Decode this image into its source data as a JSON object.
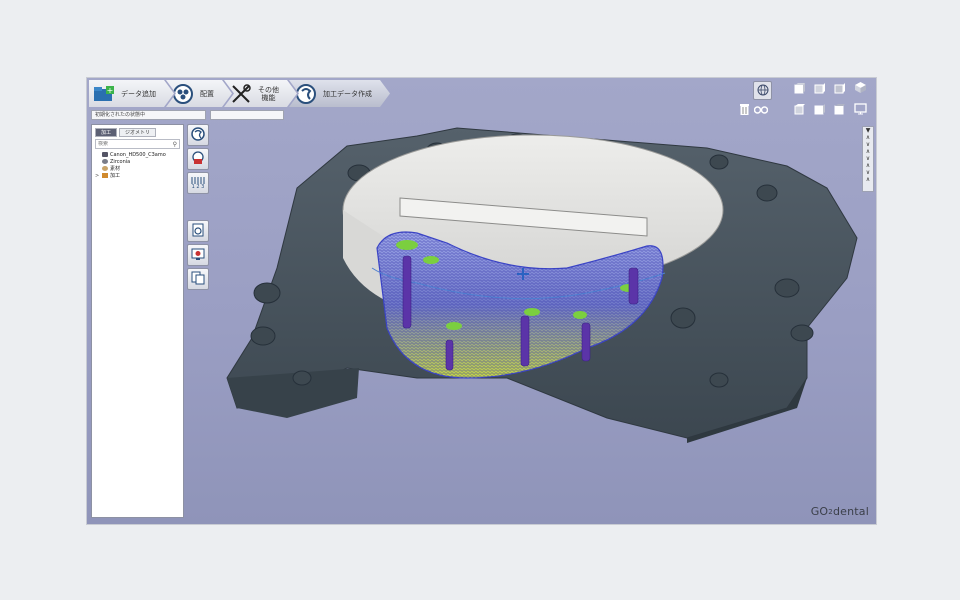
{
  "workflow": {
    "steps": [
      {
        "label": "データ追加",
        "icon": "folder-add-icon",
        "active": false
      },
      {
        "label": "配置",
        "icon": "placement-icon",
        "active": false
      },
      {
        "label": "その他\n機能",
        "icon": "tools-icon",
        "active": false
      },
      {
        "label": "加工データ作成",
        "icon": "toolpath-icon",
        "active": true
      }
    ]
  },
  "progress": {
    "label": "初期化されたの状態中",
    "value": ""
  },
  "panel": {
    "tabs": [
      {
        "label": "加工",
        "active": true
      },
      {
        "label": "ジオメトリ",
        "active": false
      }
    ],
    "search_placeholder": "検索",
    "tree": [
      {
        "label": "Canon_HD500_C3amo",
        "icon": "machine-icon",
        "expander": ""
      },
      {
        "label": "Zirconia",
        "icon": "material-icon",
        "expander": ""
      },
      {
        "label": "素材",
        "icon": "blank-icon",
        "expander": ""
      },
      {
        "label": "加工",
        "icon": "machining-icon",
        "expander": ">"
      }
    ]
  },
  "left_tools": [
    {
      "icon": "calculate-toolpath-icon"
    },
    {
      "icon": "delete-toolpath-icon"
    },
    {
      "icon": "toolpath-order-icon",
      "text": "1 2 3"
    },
    {
      "icon": "export-nc-icon"
    },
    {
      "icon": "simulation-icon"
    },
    {
      "icon": "report-icon"
    }
  ],
  "view_strip": [
    "▼",
    "∧",
    "∨",
    "∧",
    "∨",
    "∧",
    "∨",
    "∧"
  ],
  "watermark": {
    "part1": "GO",
    "part2": "2",
    "part3": "dental"
  },
  "colors": {
    "viewport_top": "#a3a7c9",
    "fixture": "#46525c",
    "blank": "#e6e6e4",
    "toolpath": "#3b3bb8",
    "part": "#c9da4a",
    "screw_channel": "#5a3aa8"
  }
}
